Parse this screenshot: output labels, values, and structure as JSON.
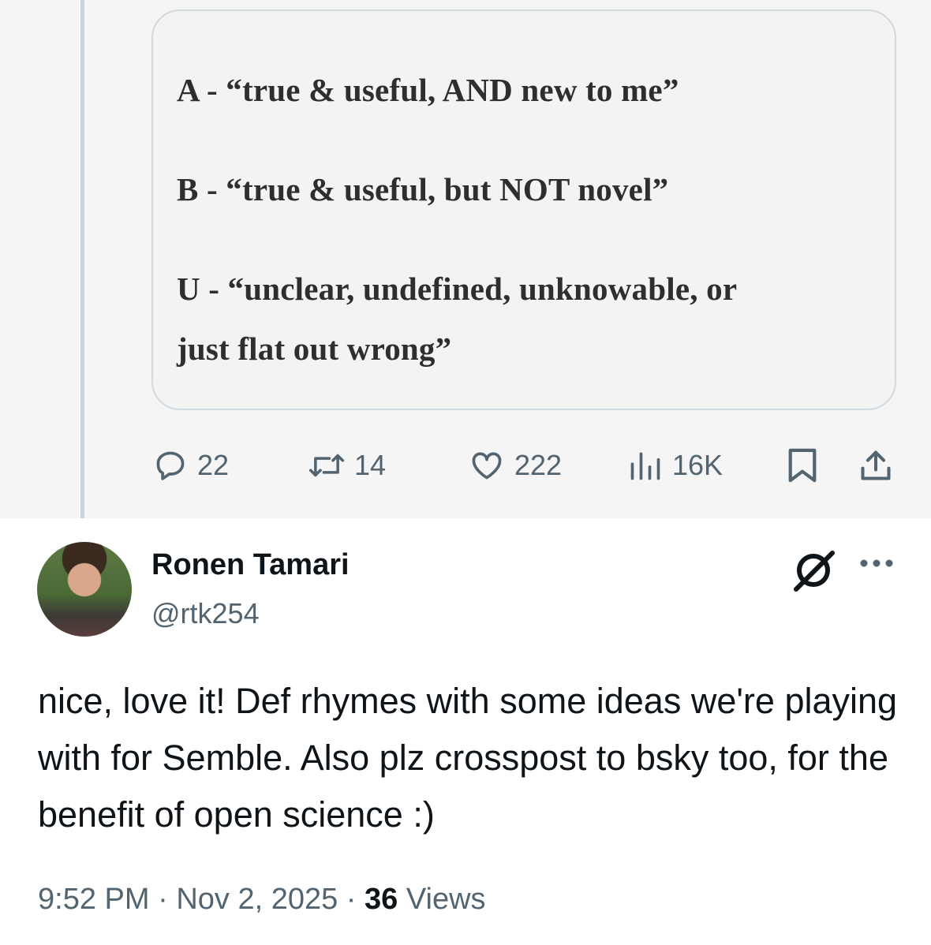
{
  "parent_tweet": {
    "media_text": {
      "line_a": "A - “true & useful, AND new to me”",
      "line_b": "B - “true & useful, but NOT novel”",
      "line_u1": "U - “unclear, undefined, unknowable, or",
      "line_u2": "just flat out wrong”"
    },
    "actions": {
      "replies": "22",
      "reposts": "14",
      "likes": "222",
      "views": "16K"
    }
  },
  "reply": {
    "author_name": "Ronen Tamari",
    "handle": "@rtk254",
    "text": "nice, love it! Def rhymes with some ideas we're playing with for Semble. Also plz crosspost to bsky too, for the benefit of open science :)",
    "time": "9:52 PM",
    "separator": "·",
    "date": "Nov 2, 2025",
    "views_count": "36",
    "views_label": "Views"
  },
  "icons": {
    "reply": "reply-icon",
    "repost": "repost-icon",
    "like": "heart-icon",
    "views": "analytics-icon",
    "bookmark": "bookmark-icon",
    "share": "share-icon",
    "grok": "grok-icon",
    "more": "more-icon"
  },
  "colors": {
    "secondary_text": "#536471",
    "primary_text": "#0f1419",
    "thread_line": "#c9d3dc"
  }
}
